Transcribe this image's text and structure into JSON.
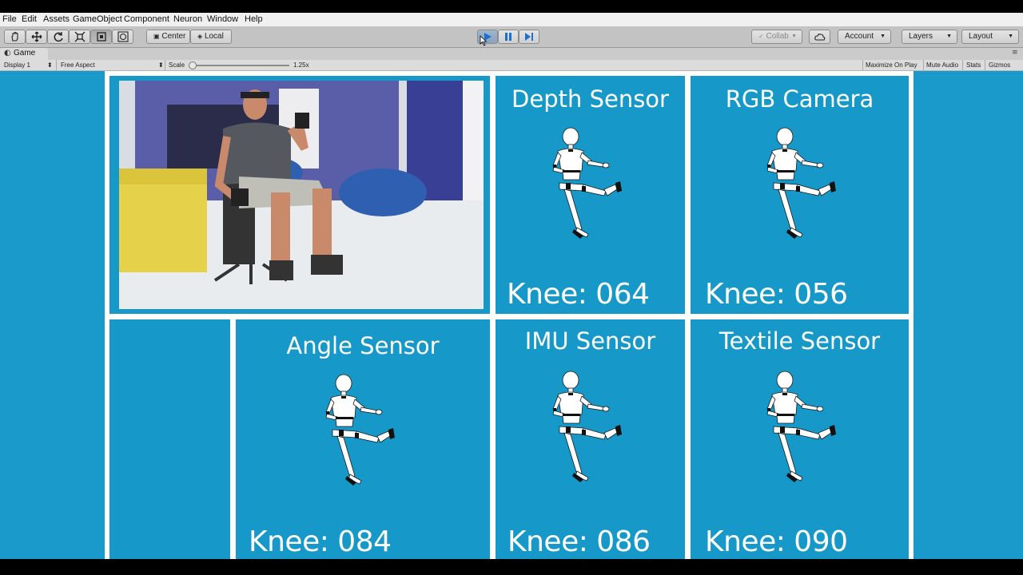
{
  "menu": [
    "File",
    "Edit",
    "Assets",
    "GameObject",
    "Component",
    "Neuron",
    "Window",
    "Help"
  ],
  "toolbar": {
    "pivot_label": "Center",
    "space_label": "Local",
    "collab_label": "Collab",
    "account_label": "Account",
    "layers_label": "Layers",
    "layout_label": "Layout"
  },
  "game_tab": {
    "title": "Game",
    "display": "Display 1",
    "aspect": "Free Aspect",
    "scale_label": "Scale",
    "scale_value": "1.25x",
    "maximize_label": "Maximize On Play",
    "mute_label": "Mute Audio",
    "stats_label": "Stats",
    "gizmos_label": "Gizmos"
  },
  "panels": {
    "depth": {
      "title": "Depth Sensor",
      "knee": "Knee: 064"
    },
    "rgb": {
      "title": "RGB Camera",
      "knee": "Knee: 056"
    },
    "angle": {
      "title": "Angle Sensor",
      "knee": "Knee: 084"
    },
    "imu": {
      "title": "IMU Sensor",
      "knee": "Knee: 086"
    },
    "textile": {
      "title": "Textile Sensor",
      "knee": "Knee: 090"
    }
  },
  "colors": {
    "game_background": "#1a9acb",
    "panel_blue": "#1698c8",
    "grid_white": "#ffffff"
  }
}
